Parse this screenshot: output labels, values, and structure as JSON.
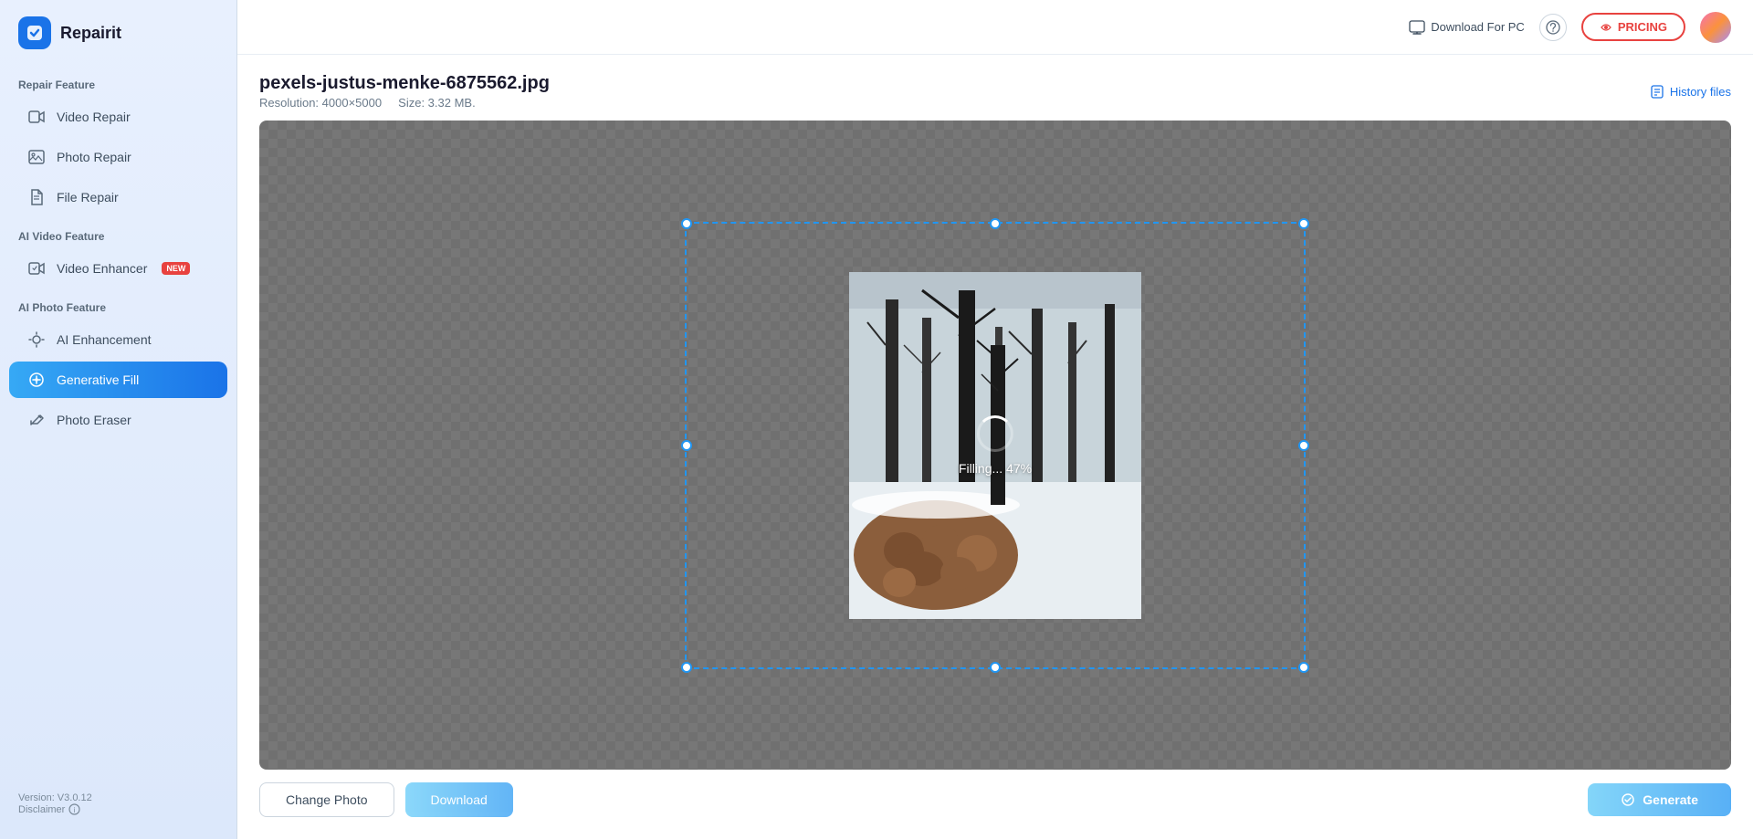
{
  "app": {
    "name": "Repairit"
  },
  "sidebar": {
    "repair_section_title": "Repair Feature",
    "items": [
      {
        "id": "video-repair",
        "label": "Video Repair",
        "icon": "video-icon",
        "active": false
      },
      {
        "id": "photo-repair",
        "label": "Photo Repair",
        "icon": "photo-icon",
        "active": false
      },
      {
        "id": "file-repair",
        "label": "File Repair",
        "icon": "file-icon",
        "active": false
      }
    ],
    "ai_video_section_title": "AI Video Feature",
    "ai_video_items": [
      {
        "id": "video-enhancer",
        "label": "Video Enhancer",
        "icon": "video-enhance-icon",
        "badge": "NEW",
        "active": false
      }
    ],
    "ai_photo_section_title": "AI Photo Feature",
    "ai_photo_items": [
      {
        "id": "ai-enhancement",
        "label": "AI Enhancement",
        "icon": "ai-icon",
        "active": false
      },
      {
        "id": "generative-fill",
        "label": "Generative Fill",
        "icon": "generative-icon",
        "active": true
      },
      {
        "id": "photo-eraser",
        "label": "Photo Eraser",
        "icon": "eraser-icon",
        "active": false
      }
    ],
    "version": "Version: V3.0.12",
    "disclaimer": "Disclaimer"
  },
  "header": {
    "download_pc_label": "Download For PC",
    "pricing_label": "PRICING",
    "history_files_label": "History files"
  },
  "file": {
    "name": "pexels-justus-menke-6875562.jpg",
    "resolution_label": "Resolution: 4000×5000",
    "size_label": "Size: 3.32 MB."
  },
  "canvas": {
    "loading_text": "Filling... 47%"
  },
  "actions": {
    "change_photo": "Change Photo",
    "download": "Download",
    "generate": "Generate"
  }
}
